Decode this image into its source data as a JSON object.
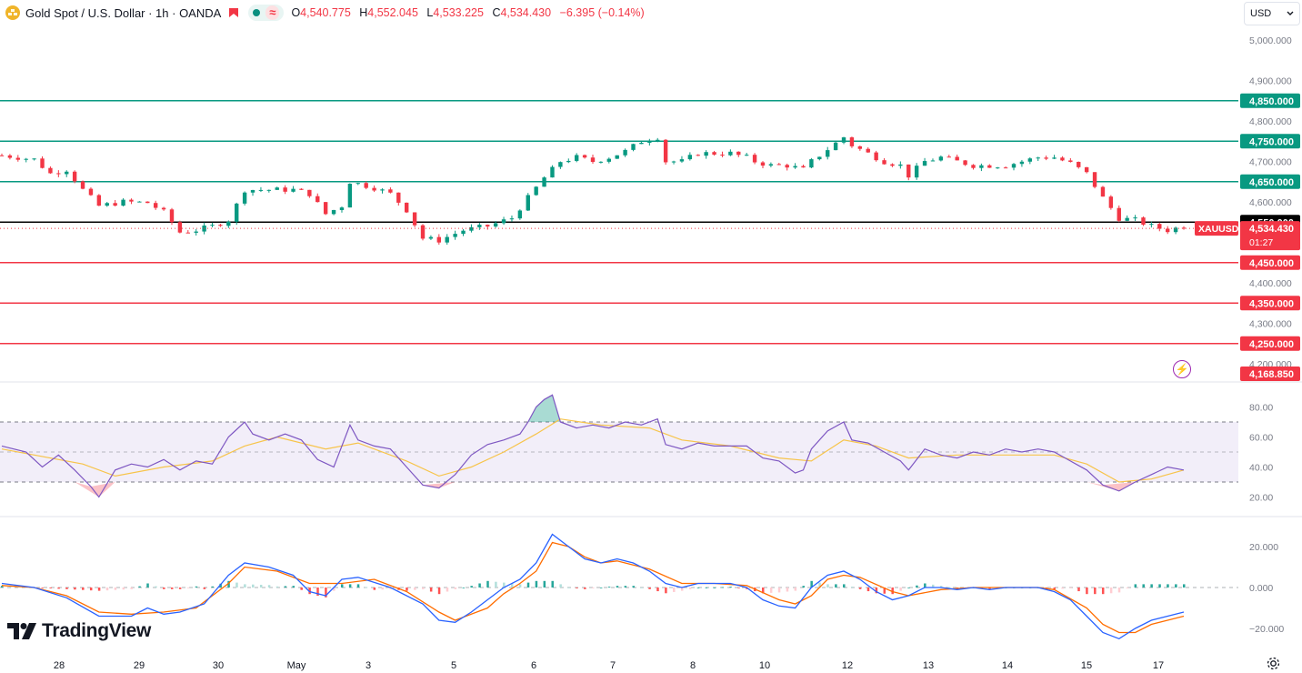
{
  "header": {
    "symbol": "Gold Spot / U.S. Dollar · 1h · OANDA",
    "ohlc": [
      {
        "key": "O",
        "value": "4,540.775"
      },
      {
        "key": "H",
        "value": "4,552.045"
      },
      {
        "key": "L",
        "value": "4,533.225"
      },
      {
        "key": "C",
        "value": "4,534.430"
      }
    ],
    "change": "−6.395 (−0.14%)"
  },
  "currency_select": {
    "value": "USD"
  },
  "brand": {
    "name": "TradingView"
  },
  "colors": {
    "up": "#089981",
    "down": "#f23645",
    "rsi": "#7e57c2",
    "rsi_ma": "#f7c44a",
    "macd": "#2962ff",
    "signal": "#ff6d00",
    "support": "#f23645",
    "resistance": "#089981"
  },
  "chart_data": [
    {
      "type": "candlestick",
      "title": "Gold Spot / U.S. Dollar · 1h · OANDA",
      "ylim": [
        4150,
        5040
      ],
      "y_ticks": [
        "5,000.000",
        "4,900.000",
        "4,800.000",
        "4,700.000",
        "4,600.000",
        "4,500.000",
        "4,400.000",
        "4,300.000",
        "4,200.000"
      ],
      "x_ticks": [
        "28",
        "29",
        "30",
        "May",
        "3",
        "5",
        "6",
        "7",
        "8",
        "10",
        "12",
        "13",
        "14",
        "15",
        "17"
      ],
      "horizontal_lines": [
        {
          "value": 4850,
          "label": "4,850.000",
          "color": "#089981"
        },
        {
          "value": 4750,
          "label": "4,750.000",
          "color": "#089981"
        },
        {
          "value": 4650,
          "label": "4,650.000",
          "color": "#089981"
        },
        {
          "value": 4550,
          "label": "4,550.000",
          "color": "#000000"
        },
        {
          "value": 4450,
          "label": "4,450.000",
          "color": "#f23645"
        },
        {
          "value": 4350,
          "label": "4,350.000",
          "color": "#f23645"
        },
        {
          "value": 4250,
          "label": "4,250.000",
          "color": "#f23645"
        }
      ],
      "last_price": {
        "symbol": "XAUUSD",
        "value": 4534.43,
        "label": "4,534.430",
        "countdown": "01:27"
      },
      "bottom_marker": {
        "value": 4168.85,
        "label": "4,168.850"
      },
      "close_path": [
        [
          0,
          4715
        ],
        [
          4,
          4705
        ],
        [
          6,
          4670
        ],
        [
          8,
          4680
        ],
        [
          10,
          4630
        ],
        [
          12,
          4590
        ],
        [
          15,
          4600
        ],
        [
          18,
          4598
        ],
        [
          20,
          4575
        ],
        [
          22,
          4525
        ],
        [
          24,
          4530
        ],
        [
          26,
          4540
        ],
        [
          28,
          4555
        ],
        [
          30,
          4630
        ],
        [
          33,
          4630
        ],
        [
          36,
          4630
        ],
        [
          38,
          4620
        ],
        [
          40,
          4570
        ],
        [
          42,
          4590
        ],
        [
          43,
          4650
        ],
        [
          46,
          4635
        ],
        [
          48,
          4620
        ],
        [
          50,
          4580
        ],
        [
          52,
          4510
        ],
        [
          54,
          4505
        ],
        [
          57,
          4530
        ],
        [
          60,
          4540
        ],
        [
          63,
          4560
        ],
        [
          65,
          4610
        ],
        [
          67,
          4660
        ],
        [
          69,
          4700
        ],
        [
          71,
          4710
        ],
        [
          73,
          4700
        ],
        [
          75,
          4710
        ],
        [
          77,
          4725
        ],
        [
          79,
          4750
        ],
        [
          81,
          4760
        ],
        [
          82,
          4700
        ],
        [
          84,
          4700
        ],
        [
          86,
          4720
        ],
        [
          88,
          4720
        ],
        [
          90,
          4720
        ],
        [
          92,
          4710
        ],
        [
          93,
          4700
        ],
        [
          95,
          4690
        ],
        [
          97,
          4690
        ],
        [
          99,
          4680
        ],
        [
          100,
          4700
        ],
        [
          102,
          4730
        ],
        [
          104,
          4760
        ],
        [
          105,
          4740
        ],
        [
          107,
          4720
        ],
        [
          109,
          4700
        ],
        [
          111,
          4690
        ],
        [
          112,
          4665
        ],
        [
          114,
          4700
        ],
        [
          116,
          4710
        ],
        [
          118,
          4700
        ],
        [
          120,
          4690
        ],
        [
          122,
          4690
        ],
        [
          124,
          4690
        ],
        [
          126,
          4700
        ],
        [
          128,
          4710
        ],
        [
          130,
          4710
        ],
        [
          132,
          4695
        ],
        [
          134,
          4670
        ],
        [
          136,
          4610
        ],
        [
          138,
          4560
        ],
        [
          140,
          4555
        ],
        [
          142,
          4540
        ],
        [
          144,
          4530
        ],
        [
          146,
          4540
        ]
      ],
      "rsi": {
        "ylim": [
          10,
          95
        ],
        "ticks": [
          "80.00",
          "60.00",
          "40.00",
          "20.00"
        ],
        "band": [
          30,
          70
        ],
        "midline": 50,
        "line": [
          [
            0,
            54
          ],
          [
            3,
            50
          ],
          [
            5,
            40
          ],
          [
            7,
            48
          ],
          [
            9,
            38
          ],
          [
            11,
            27
          ],
          [
            12,
            20
          ],
          [
            14,
            38
          ],
          [
            16,
            42
          ],
          [
            18,
            40
          ],
          [
            20,
            45
          ],
          [
            22,
            38
          ],
          [
            24,
            44
          ],
          [
            26,
            42
          ],
          [
            28,
            60
          ],
          [
            30,
            70
          ],
          [
            31,
            62
          ],
          [
            33,
            58
          ],
          [
            35,
            62
          ],
          [
            37,
            58
          ],
          [
            39,
            45
          ],
          [
            41,
            40
          ],
          [
            43,
            68
          ],
          [
            44,
            58
          ],
          [
            46,
            54
          ],
          [
            48,
            52
          ],
          [
            50,
            40
          ],
          [
            52,
            28
          ],
          [
            54,
            26
          ],
          [
            56,
            35
          ],
          [
            58,
            48
          ],
          [
            60,
            55
          ],
          [
            62,
            58
          ],
          [
            64,
            62
          ],
          [
            65,
            70
          ],
          [
            66,
            80
          ],
          [
            67,
            85
          ],
          [
            68,
            88
          ],
          [
            69,
            70
          ],
          [
            71,
            66
          ],
          [
            73,
            68
          ],
          [
            75,
            66
          ],
          [
            77,
            70
          ],
          [
            79,
            68
          ],
          [
            81,
            72
          ],
          [
            82,
            55
          ],
          [
            84,
            52
          ],
          [
            86,
            56
          ],
          [
            88,
            54
          ],
          [
            90,
            54
          ],
          [
            92,
            54
          ],
          [
            94,
            46
          ],
          [
            96,
            44
          ],
          [
            98,
            36
          ],
          [
            99,
            38
          ],
          [
            100,
            52
          ],
          [
            102,
            64
          ],
          [
            104,
            70
          ],
          [
            105,
            58
          ],
          [
            107,
            56
          ],
          [
            109,
            50
          ],
          [
            111,
            44
          ],
          [
            112,
            38
          ],
          [
            114,
            52
          ],
          [
            116,
            48
          ],
          [
            118,
            46
          ],
          [
            120,
            50
          ],
          [
            122,
            48
          ],
          [
            124,
            52
          ],
          [
            126,
            50
          ],
          [
            128,
            52
          ],
          [
            130,
            50
          ],
          [
            132,
            44
          ],
          [
            134,
            38
          ],
          [
            136,
            28
          ],
          [
            138,
            24
          ],
          [
            140,
            30
          ],
          [
            142,
            35
          ],
          [
            144,
            40
          ],
          [
            146,
            38
          ]
        ],
        "ma": [
          [
            0,
            52
          ],
          [
            10,
            42
          ],
          [
            14,
            34
          ],
          [
            20,
            40
          ],
          [
            26,
            44
          ],
          [
            30,
            54
          ],
          [
            34,
            60
          ],
          [
            40,
            52
          ],
          [
            44,
            56
          ],
          [
            50,
            44
          ],
          [
            54,
            34
          ],
          [
            58,
            40
          ],
          [
            62,
            50
          ],
          [
            66,
            62
          ],
          [
            69,
            72
          ],
          [
            74,
            68
          ],
          [
            80,
            66
          ],
          [
            84,
            58
          ],
          [
            90,
            54
          ],
          [
            96,
            46
          ],
          [
            100,
            44
          ],
          [
            104,
            58
          ],
          [
            108,
            54
          ],
          [
            112,
            46
          ],
          [
            118,
            48
          ],
          [
            124,
            48
          ],
          [
            130,
            48
          ],
          [
            134,
            42
          ],
          [
            138,
            30
          ],
          [
            142,
            32
          ],
          [
            146,
            38
          ]
        ]
      },
      "macd": {
        "ylim": [
          -29,
          30
        ],
        "ticks": [
          "20.000",
          "0.000",
          "−20.000"
        ],
        "macd_line": [
          [
            0,
            2
          ],
          [
            4,
            0
          ],
          [
            8,
            -5
          ],
          [
            12,
            -14
          ],
          [
            16,
            -14
          ],
          [
            18,
            -10
          ],
          [
            20,
            -13
          ],
          [
            22,
            -12
          ],
          [
            25,
            -8
          ],
          [
            28,
            6
          ],
          [
            30,
            12
          ],
          [
            33,
            10
          ],
          [
            36,
            6
          ],
          [
            38,
            -2
          ],
          [
            40,
            -4
          ],
          [
            42,
            4
          ],
          [
            44,
            5
          ],
          [
            48,
            0
          ],
          [
            52,
            -8
          ],
          [
            54,
            -16
          ],
          [
            56,
            -17
          ],
          [
            58,
            -12
          ],
          [
            60,
            -6
          ],
          [
            62,
            0
          ],
          [
            64,
            4
          ],
          [
            66,
            12
          ],
          [
            68,
            26
          ],
          [
            70,
            20
          ],
          [
            72,
            14
          ],
          [
            74,
            12
          ],
          [
            76,
            14
          ],
          [
            78,
            12
          ],
          [
            80,
            8
          ],
          [
            82,
            2
          ],
          [
            84,
            0
          ],
          [
            86,
            2
          ],
          [
            88,
            2
          ],
          [
            90,
            2
          ],
          [
            92,
            0
          ],
          [
            94,
            -6
          ],
          [
            96,
            -9
          ],
          [
            98,
            -10
          ],
          [
            100,
            0
          ],
          [
            102,
            6
          ],
          [
            104,
            8
          ],
          [
            106,
            4
          ],
          [
            108,
            -2
          ],
          [
            110,
            -6
          ],
          [
            112,
            -4
          ],
          [
            114,
            0
          ],
          [
            116,
            0
          ],
          [
            118,
            -1
          ],
          [
            120,
            0
          ],
          [
            122,
            -1
          ],
          [
            124,
            0
          ],
          [
            126,
            0
          ],
          [
            128,
            0
          ],
          [
            130,
            -2
          ],
          [
            132,
            -6
          ],
          [
            134,
            -14
          ],
          [
            136,
            -22
          ],
          [
            138,
            -25
          ],
          [
            140,
            -20
          ],
          [
            142,
            -16
          ],
          [
            144,
            -14
          ],
          [
            146,
            -12
          ]
        ],
        "signal_line": [
          [
            0,
            1
          ],
          [
            4,
            0
          ],
          [
            8,
            -4
          ],
          [
            12,
            -12
          ],
          [
            16,
            -13
          ],
          [
            20,
            -12
          ],
          [
            24,
            -10
          ],
          [
            28,
            2
          ],
          [
            30,
            10
          ],
          [
            34,
            8
          ],
          [
            38,
            2
          ],
          [
            42,
            2
          ],
          [
            46,
            4
          ],
          [
            50,
            -2
          ],
          [
            54,
            -12
          ],
          [
            56,
            -16
          ],
          [
            60,
            -10
          ],
          [
            62,
            -3
          ],
          [
            64,
            2
          ],
          [
            66,
            8
          ],
          [
            68,
            22
          ],
          [
            70,
            20
          ],
          [
            72,
            15
          ],
          [
            74,
            12
          ],
          [
            76,
            13
          ],
          [
            80,
            9
          ],
          [
            84,
            2
          ],
          [
            88,
            2
          ],
          [
            92,
            1
          ],
          [
            96,
            -6
          ],
          [
            98,
            -8
          ],
          [
            100,
            -4
          ],
          [
            102,
            4
          ],
          [
            104,
            6
          ],
          [
            106,
            5
          ],
          [
            110,
            -2
          ],
          [
            112,
            -4
          ],
          [
            116,
            -1
          ],
          [
            120,
            0
          ],
          [
            124,
            0
          ],
          [
            128,
            0
          ],
          [
            130,
            -1
          ],
          [
            134,
            -10
          ],
          [
            136,
            -18
          ],
          [
            138,
            -22
          ],
          [
            140,
            -22
          ],
          [
            142,
            -18
          ],
          [
            144,
            -16
          ],
          [
            146,
            -14
          ]
        ]
      }
    }
  ]
}
